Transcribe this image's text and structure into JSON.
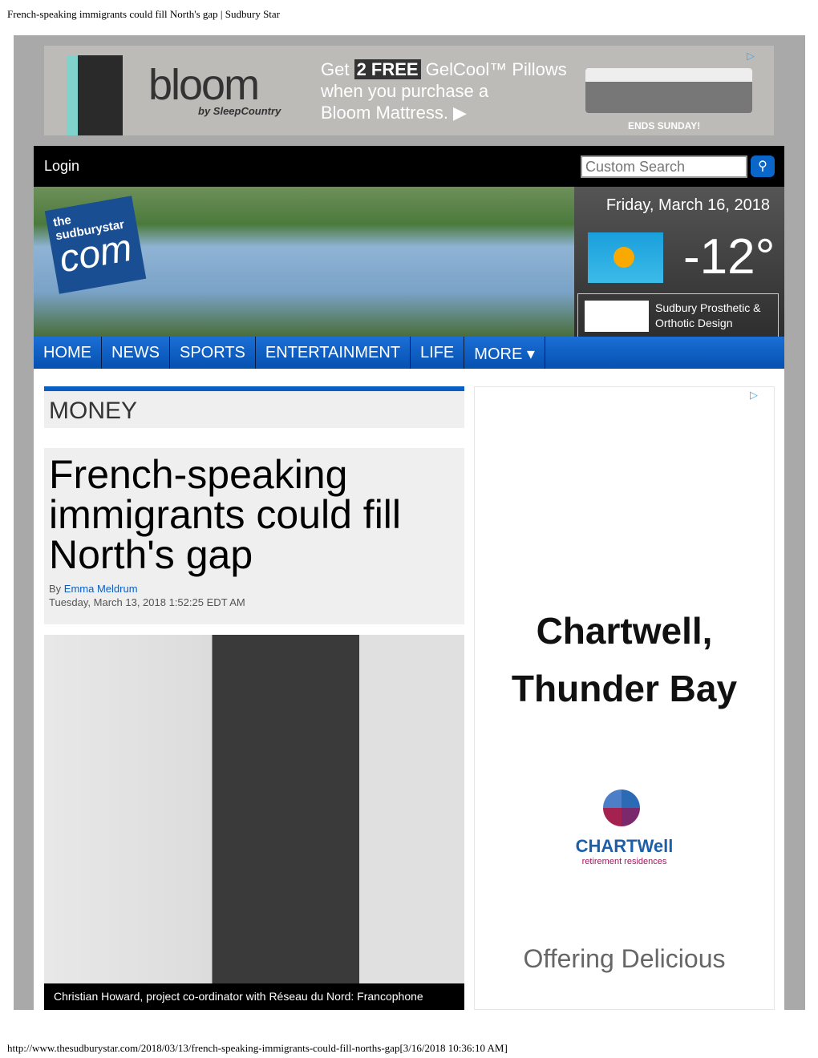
{
  "browser": {
    "title": "French-speaking immigrants could fill North's gap | Sudbury Star",
    "url": "http://www.thesudburystar.com/2018/03/13/french-speaking-immigrants-could-fill-norths-gap[3/16/2018 10:36:10 AM]"
  },
  "top_ad": {
    "brand": "bloom",
    "by": "by SleepCountry",
    "line1_pre": "Get ",
    "line1_bold": "2 FREE",
    "line1_post": " GelCool™ Pillows",
    "line2": "when you purchase a",
    "line3": "Bloom Mattress. ▶",
    "ends": "ENDS SUNDAY!"
  },
  "header": {
    "login": "Login",
    "search_placeholder": "Custom Search",
    "date": "Friday, March 16, 2018",
    "temperature": "-12°",
    "weather_icon": "partly-sunny-icon",
    "sponsor": "Sudbury Prosthetic & Orthotic Design",
    "logo_top": "the sudburystar",
    "logo_bottom": "com"
  },
  "nav": [
    "HOME",
    "NEWS",
    "SPORTS",
    "ENTERTAINMENT",
    "LIFE",
    "MORE ▾"
  ],
  "section": "MONEY",
  "article": {
    "title": "French-speaking immigrants could fill North's gap",
    "by": "By ",
    "author": "Emma Meldrum",
    "timestamp": "Tuesday, March 13, 2018 1:52:25 EDT AM",
    "caption": "Christian Howard, project co-ordinator with Réseau du Nord: Francophone"
  },
  "right_ad": {
    "title": "Chartwell, Thunder Bay",
    "brand": "CHARTWell",
    "brand_sub": "retirement residences",
    "tagline": "Offering Delicious"
  },
  "colors": {
    "nav": "#0a5fc4",
    "topbar": "#000000"
  }
}
